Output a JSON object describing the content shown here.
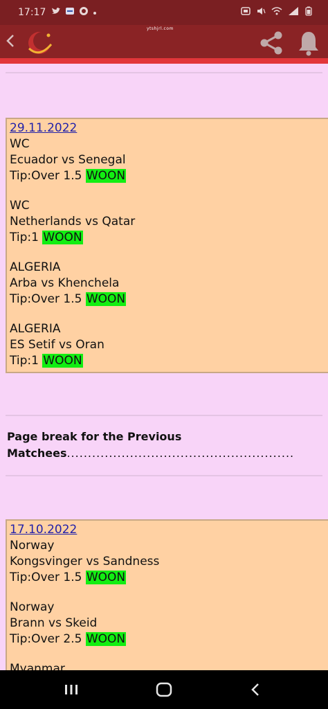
{
  "status": {
    "time": "17:17",
    "left_icons": [
      "twitter-icon",
      "app-icon",
      "whatsapp-icon",
      "dot-icon"
    ],
    "right_icons": [
      "notification-icon",
      "volume-icon",
      "wifi-icon",
      "signal-icon",
      "battery-icon"
    ]
  },
  "appbar": {
    "url_text": "ytshjrl.com",
    "back_icon": "back-icon",
    "share_icon": "share-icon",
    "bell_icon": "bell-icon"
  },
  "sections": [
    {
      "date": "29.11.2022",
      "entries": [
        {
          "league": "WC",
          "match": "Ecuador vs Senegal",
          "tip": "Tip:Over 1.5",
          "result": "WOON"
        },
        {
          "league": "WC",
          "match": "Netherlands vs Qatar",
          "tip": "Tip:1",
          "result": "WOON"
        },
        {
          "league": "ALGERIA",
          "match": "Arba vs Khenchela",
          "tip": "Tip:Over 1.5",
          "result": "WOON"
        },
        {
          "league": "ALGERIA",
          "match": "ES Setif vs Oran",
          "tip": "Tip:1",
          "result": "WOON"
        }
      ]
    },
    {
      "date": "17.10.2022",
      "entries": [
        {
          "league": "Norway",
          "match": "Kongsvinger vs Sandness",
          "tip": "Tip:Over 1.5",
          "result": "WOON"
        },
        {
          "league": "Norway",
          "match": "Brann vs Skeid",
          "tip": "Tip:Over 2.5",
          "result": "WOON"
        },
        {
          "league": "Myanmar",
          "match": "",
          "tip": "",
          "result": ""
        }
      ]
    }
  ],
  "page_break": {
    "line1": "Page break for the Previous",
    "line2": "Matchees",
    "dots": "......................................................"
  },
  "colors": {
    "page_bg": "#f8d4f8",
    "card_bg": "#ffd1a3",
    "won_bg": "#12ee12",
    "appbar": "#8a2325"
  }
}
